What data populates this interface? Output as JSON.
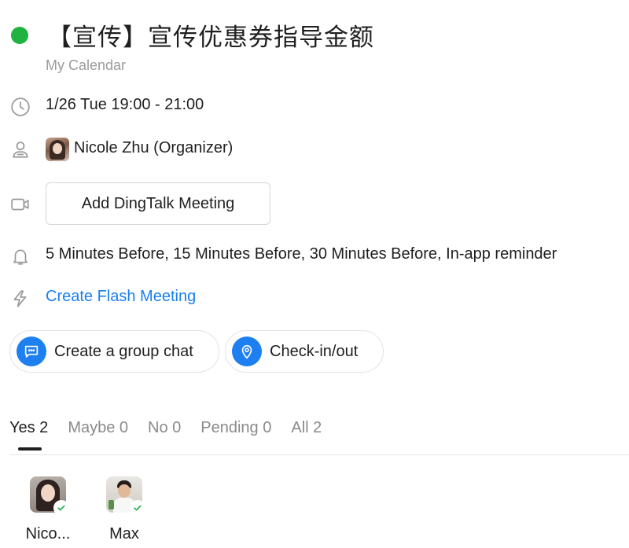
{
  "event": {
    "title": "【宣传】宣传优惠券指导金额",
    "calendar": "My Calendar",
    "status_color": "#21b33f",
    "time": "1/26 Tue 19:00 - 21:00",
    "organizer": "Nicole Zhu (Organizer)",
    "meeting_button": "Add DingTalk Meeting",
    "reminders": "5 Minutes Before, 15 Minutes Before, 30 Minutes Before, In-app reminder",
    "flash_meeting_link": "Create Flash Meeting"
  },
  "actions": {
    "group_chat": "Create a group chat",
    "checkin": "Check-in/out"
  },
  "tabs": [
    {
      "label": "Yes 2",
      "active": true
    },
    {
      "label": "Maybe 0",
      "active": false
    },
    {
      "label": "No 0",
      "active": false
    },
    {
      "label": "Pending 0",
      "active": false
    },
    {
      "label": "All 2",
      "active": false
    }
  ],
  "attendees": [
    {
      "name": "Nico...",
      "status": "accepted"
    },
    {
      "name": "Max",
      "status": "accepted"
    }
  ],
  "colors": {
    "accent": "#1a7ff0",
    "status_green": "#21b33f",
    "check_green": "#2bb553"
  },
  "icons": [
    "clock-icon",
    "person-icon",
    "video-icon",
    "bell-icon",
    "flash-icon",
    "chat-icon",
    "location-pin-icon",
    "check-icon"
  ]
}
